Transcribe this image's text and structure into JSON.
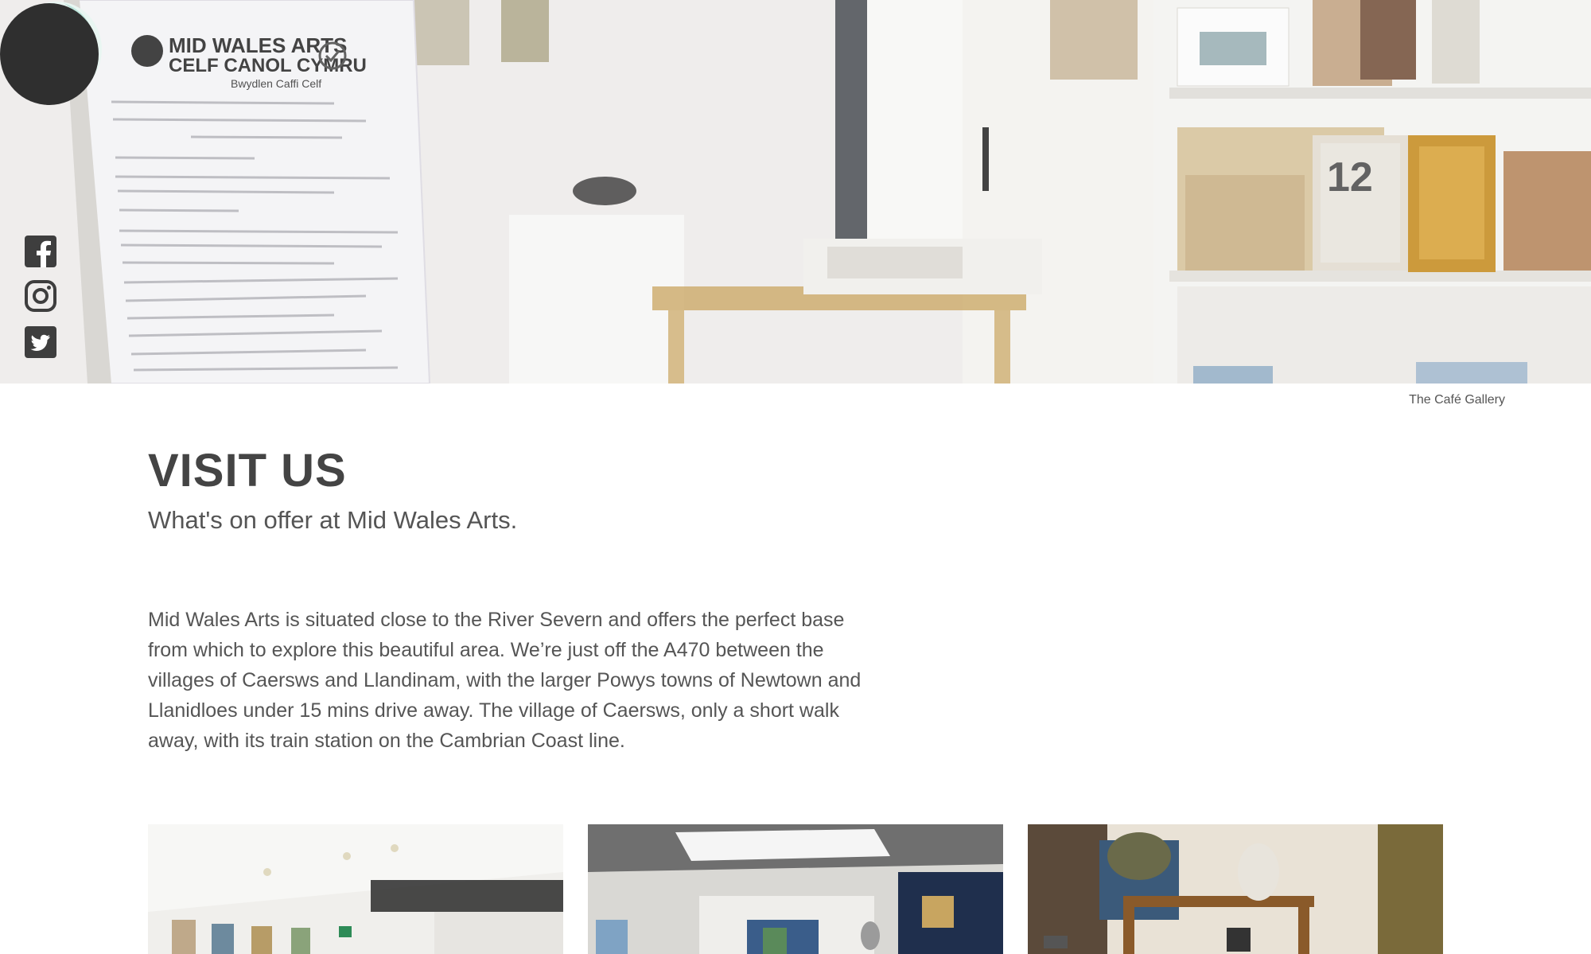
{
  "nav": {
    "menu_icon": "hamburger-menu-icon",
    "language_label": "Cy"
  },
  "social": [
    {
      "name": "facebook-icon"
    },
    {
      "name": "instagram-icon"
    },
    {
      "name": "twitter-icon"
    }
  ],
  "hero": {
    "caption": "The Café Gallery",
    "menu_sign_title_line1": "MID WALES ARTS",
    "menu_sign_title_line2": "CELF CANOL CYMRU",
    "menu_sign_subtitle": "Bwydlen Caffi Celf",
    "calendar_number": "12"
  },
  "content": {
    "title": "VISIT US",
    "subtitle": "What's on offer at Mid Wales Arts.",
    "body": "Mid Wales Arts is situated close to the River Severn and offers the perfect base from which to explore this beautiful area. We’re just off the A470 between the villages of Caersws and Llandinam, with the larger Powys towns of Newtown and Llanidloes under 15 mins drive away. The village of Caersws, only a short walk away, with its train station on the Cambrian Coast line."
  },
  "colors": {
    "text": "#4d4d4d",
    "logo_dark": "#2f2f2f",
    "logo_accent": "#bfe6dc"
  }
}
